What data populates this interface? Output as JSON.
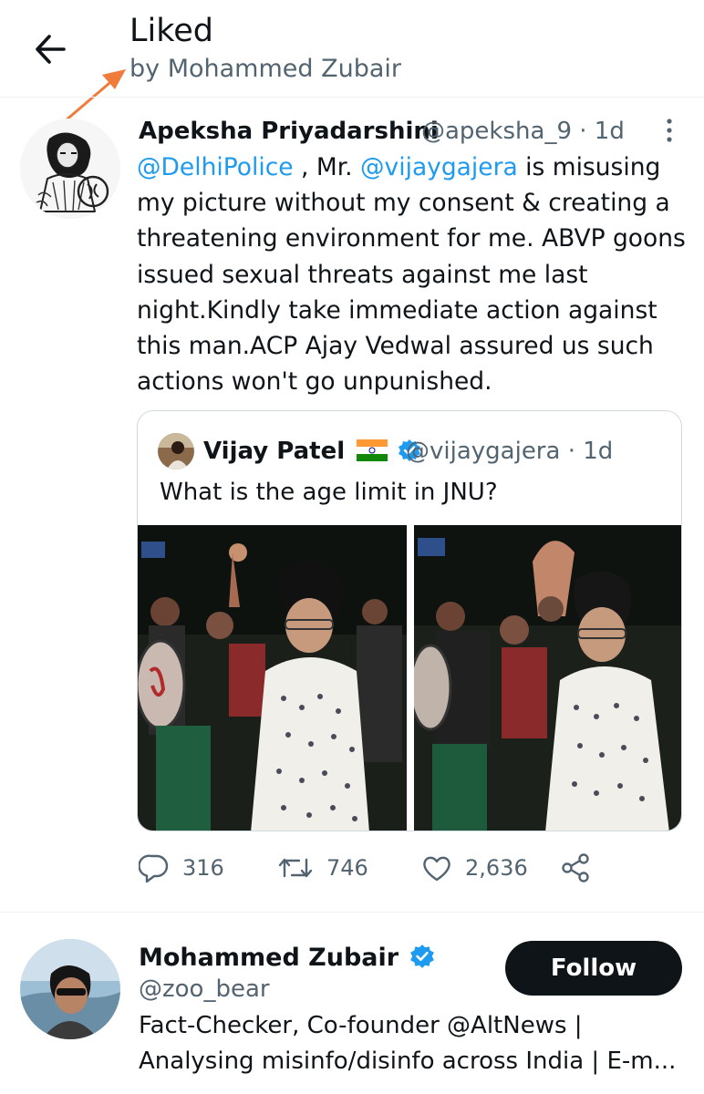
{
  "header": {
    "title": "Liked",
    "subtitle": "by Mohammed Zubair",
    "arrow_color": "#f07c3c"
  },
  "tweet": {
    "author_name": "Apeksha Priyadarshini",
    "author_meta": "@apeksha_9 · 1d",
    "body": {
      "mention1": "@DelhiPolice",
      "text1": " , Mr. ",
      "mention2": "@vijaygajera",
      "text2": " is misusing",
      "line2": "my picture without my consent & creating a",
      "line3": "threatening environment for me. ABVP goons",
      "line4": "issued sexual threats against me last",
      "line5": "night.Kindly take immediate action against",
      "line6": "this man.ACP Ajay Vedwal assured us such",
      "line7": "actions won't go unpunished."
    },
    "quote": {
      "author_name": "Vijay Patel",
      "author_meta": "@vijaygajera · 1d",
      "text": "What is the age limit in JNU?"
    },
    "actions": {
      "replies": "316",
      "retweets": "746",
      "likes": "2,636"
    }
  },
  "profile": {
    "name": "Mohammed Zubair",
    "handle": "@zoo_bear",
    "follow_label": "Follow",
    "bio_line1": "Fact-Checker, Co-founder @AltNews |",
    "bio_line2": "Analysing misinfo/disinfo across India | E-m..."
  },
  "colors": {
    "link": "#1d9bf0",
    "verified": "#1d9bf0",
    "muted": "#536471",
    "button_bg": "#0f1419"
  }
}
